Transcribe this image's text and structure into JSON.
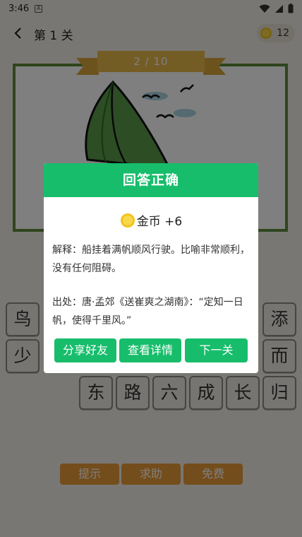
{
  "status_bar": {
    "time": "3:46",
    "notification_glyph": "A"
  },
  "header": {
    "level_title": "第 1 关",
    "coins": "12"
  },
  "progress": {
    "label": "2 / 10",
    "current": 2,
    "total": 10
  },
  "tiles": [
    "鸟",
    "添",
    "少",
    "而",
    "东",
    "路",
    "六",
    "成",
    "长",
    "归"
  ],
  "bottom_buttons": {
    "hint": "提示",
    "help": "求助",
    "free": "免费"
  },
  "dialog": {
    "title": "回答正确",
    "reward_label": "金币 +6",
    "explanation": "解释：船挂着满帆顺风行驶。比喻非常顺利，没有任何阻碍。",
    "source": "出处：唐·孟郊《送崔爽之湖南》：“定知一日帆，使得千里风。”",
    "share_button": "分享好友",
    "details_button": "查看详情",
    "next_button": "下一关"
  },
  "colors": {
    "accent_green": "#17bd6b",
    "frame_green": "#5e8b3a",
    "orange": "#e89a38",
    "ribbon_gold": "#e8b84a"
  },
  "icons": [
    "wifi-icon",
    "signal-icon",
    "battery-icon",
    "back-arrow-icon",
    "coin-icon"
  ]
}
